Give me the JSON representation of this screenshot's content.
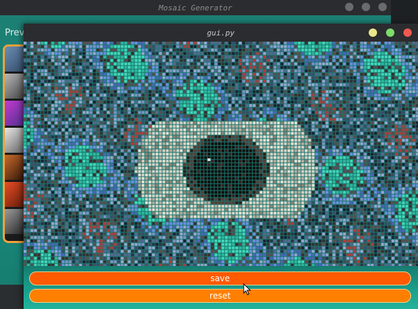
{
  "back_window": {
    "title": "Mosaic Generator",
    "preview_label": "Previ",
    "thumbnail_count": 7
  },
  "front_window": {
    "title": "gui.py",
    "buttons": {
      "save_label": "save",
      "reset_label": "reset"
    }
  },
  "colors": {
    "accent_save": "#ff5a00",
    "accent_reset": "#ff7f00",
    "teal_background": "#1c8a7e",
    "minimize": "#e9e58a",
    "maximize": "#7ddc6b",
    "close": "#f0594f"
  },
  "icons": [
    "minimize-icon",
    "maximize-icon",
    "close-icon",
    "mouse-cursor-icon"
  ]
}
